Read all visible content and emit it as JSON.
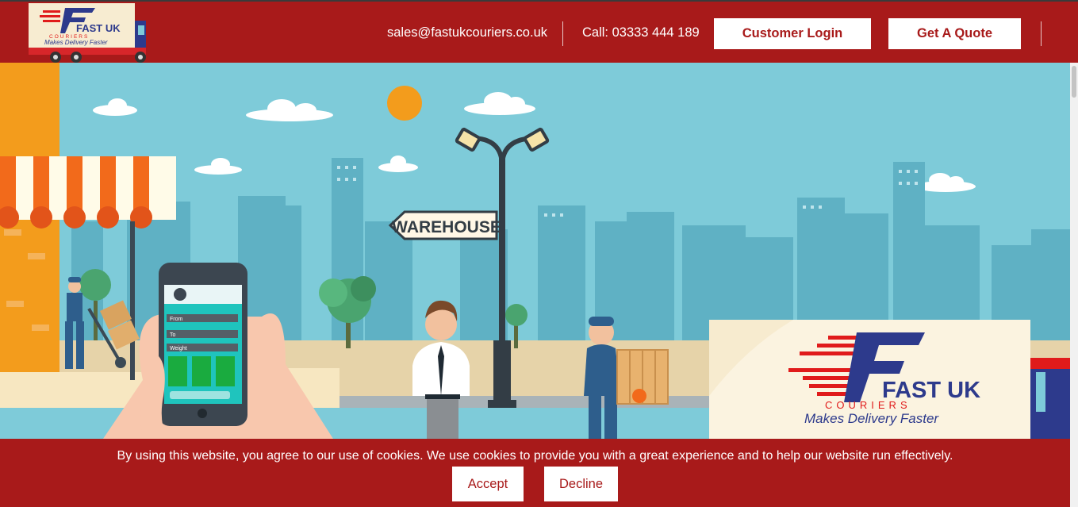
{
  "header": {
    "logo_text": "FAST UK",
    "logo_subtext": "COURIERS",
    "logo_tagline": "Makes Delivery Faster",
    "email": "sales@fastukcouriers.co.uk",
    "phone": "Call: 03333 444 189",
    "login_label": "Customer Login",
    "quote_label": "Get A Quote"
  },
  "hero": {
    "sign_text": "WAREHOUSE",
    "phone_fields": [
      "From",
      "To",
      "Weight"
    ],
    "van_logo_text": "FAST UK",
    "van_logo_subtext": "COURIERS",
    "van_tagline": "Makes Delivery Faster"
  },
  "cookie": {
    "message": "By using this website, you agree to our use of cookies. We use cookies to provide you with a great experience and to help our website run effectively.",
    "accept_label": "Accept",
    "decline_label": "Decline"
  },
  "colors": {
    "brand_red": "#a81a1a",
    "sky": "#7ecbd9",
    "logo_blue": "#2d3a8c",
    "logo_red": "#e01b1b"
  }
}
